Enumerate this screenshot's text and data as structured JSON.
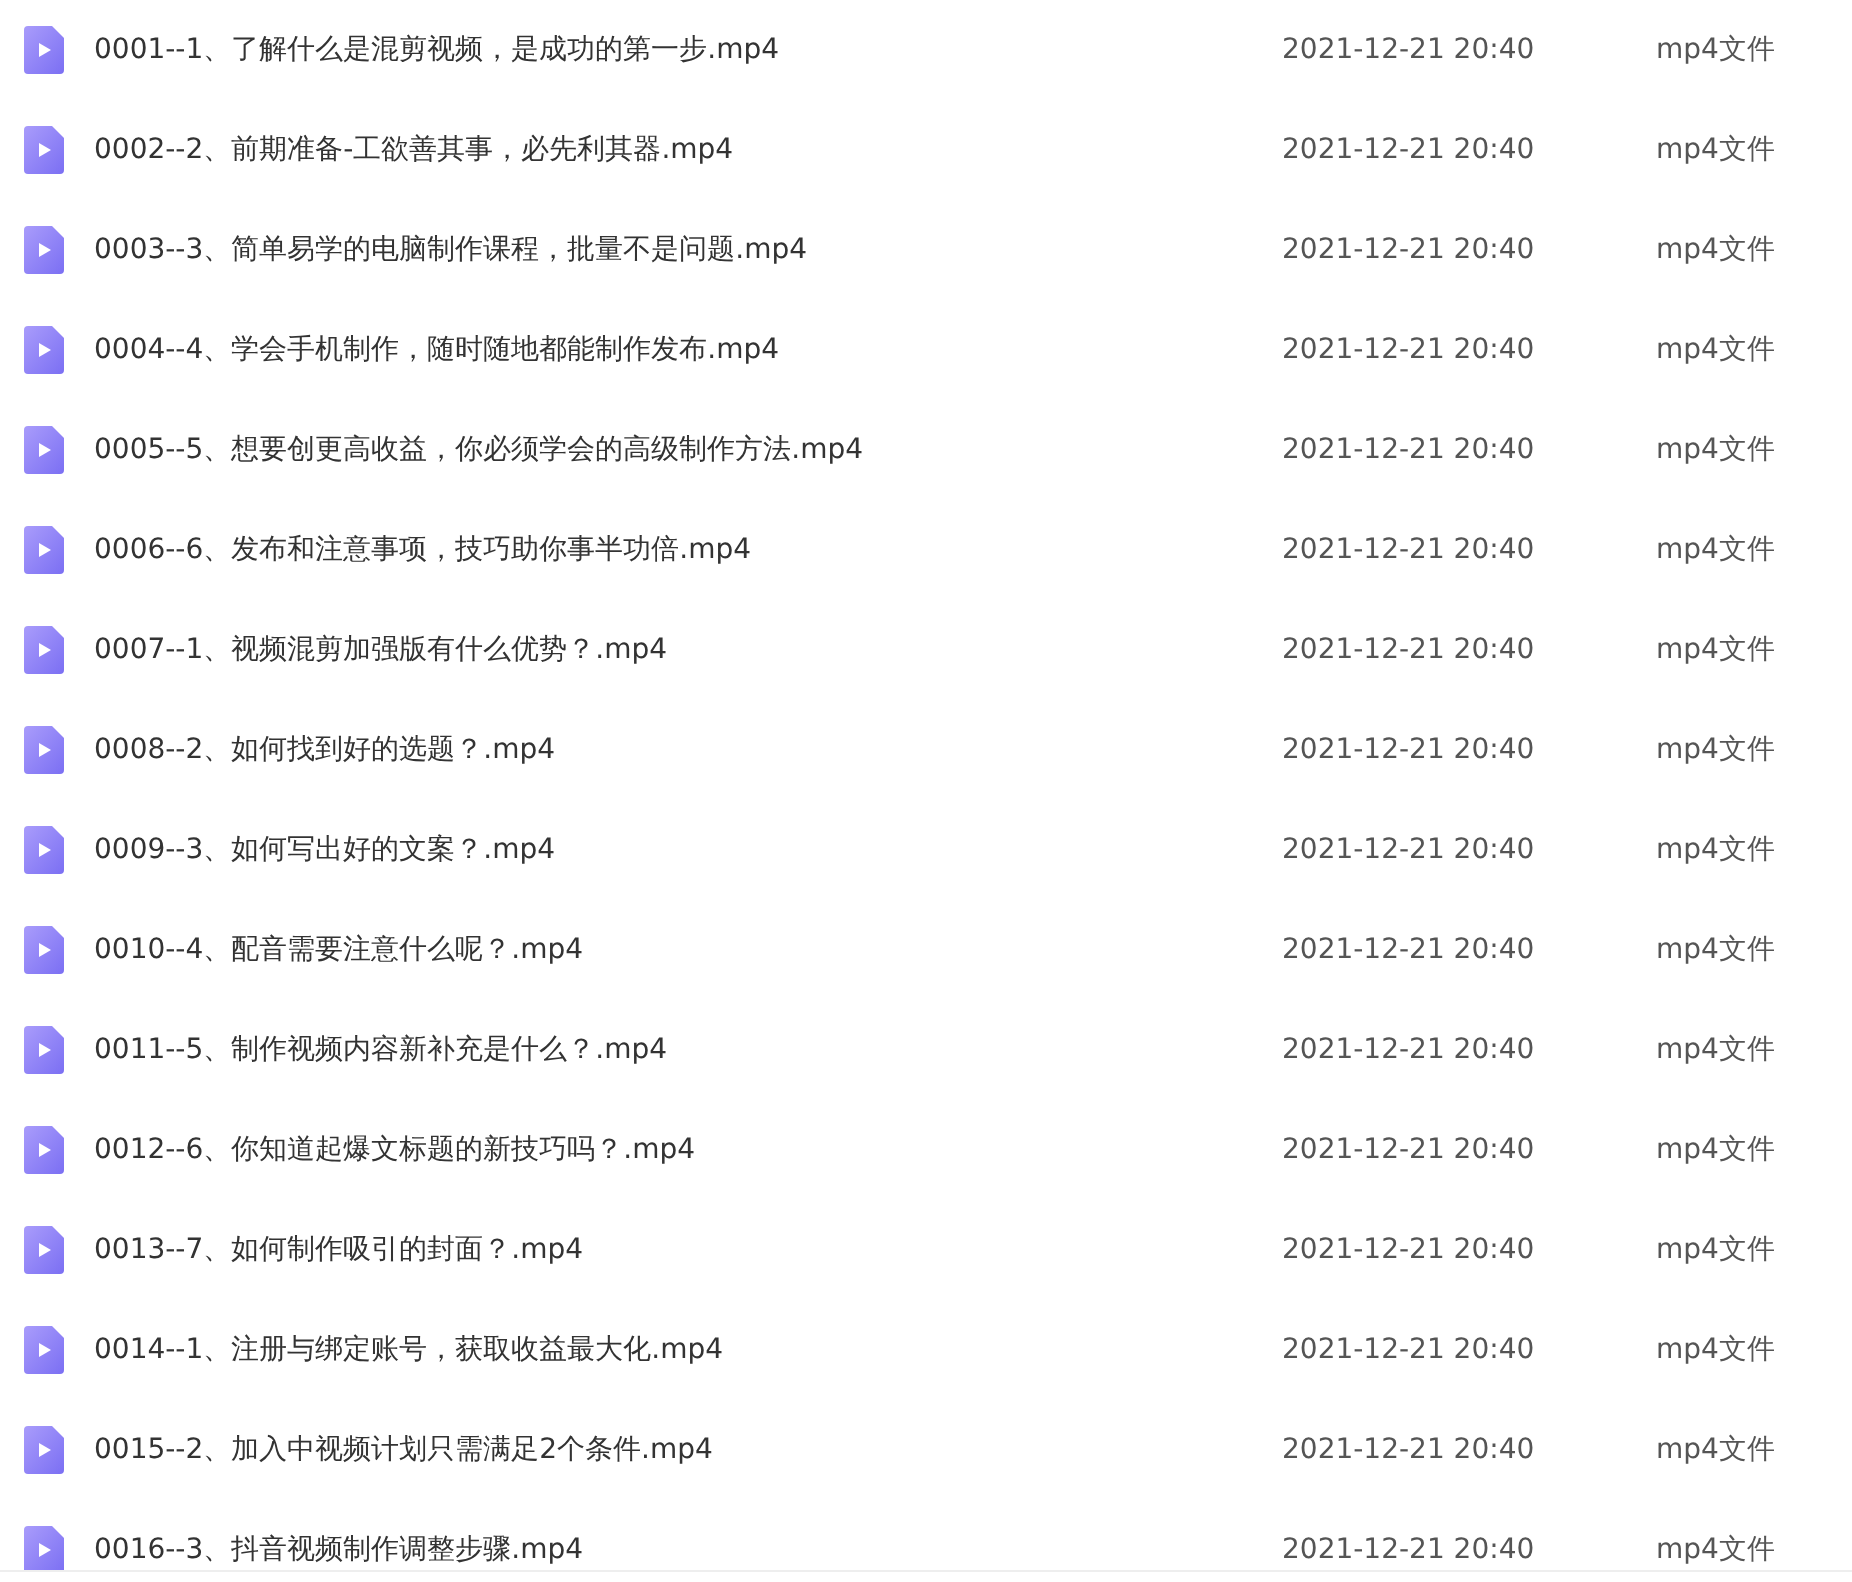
{
  "files": [
    {
      "name": "0001--1、了解什么是混剪视频，是成功的第一步.mp4",
      "modified": "2021-12-21 20:40",
      "type": "mp4文件"
    },
    {
      "name": "0002--2、前期准备-工欲善其事，必先利其器.mp4",
      "modified": "2021-12-21 20:40",
      "type": "mp4文件"
    },
    {
      "name": "0003--3、简单易学的电脑制作课程，批量不是问题.mp4",
      "modified": "2021-12-21 20:40",
      "type": "mp4文件"
    },
    {
      "name": "0004--4、学会手机制作，随时随地都能制作发布.mp4",
      "modified": "2021-12-21 20:40",
      "type": "mp4文件"
    },
    {
      "name": "0005--5、想要创更高收益，你必须学会的高级制作方法.mp4",
      "modified": "2021-12-21 20:40",
      "type": "mp4文件"
    },
    {
      "name": "0006--6、发布和注意事项，技巧助你事半功倍.mp4",
      "modified": "2021-12-21 20:40",
      "type": "mp4文件"
    },
    {
      "name": "0007--1、视频混剪加强版有什么优势？.mp4",
      "modified": "2021-12-21 20:40",
      "type": "mp4文件"
    },
    {
      "name": "0008--2、如何找到好的选题？.mp4",
      "modified": "2021-12-21 20:40",
      "type": "mp4文件"
    },
    {
      "name": "0009--3、如何写出好的文案？.mp4",
      "modified": "2021-12-21 20:40",
      "type": "mp4文件"
    },
    {
      "name": "0010--4、配音需要注意什么呢？.mp4",
      "modified": "2021-12-21 20:40",
      "type": "mp4文件"
    },
    {
      "name": "0011--5、制作视频内容新补充是什么？.mp4",
      "modified": "2021-12-21 20:40",
      "type": "mp4文件"
    },
    {
      "name": "0012--6、你知道起爆文标题的新技巧吗？.mp4",
      "modified": "2021-12-21 20:40",
      "type": "mp4文件"
    },
    {
      "name": "0013--7、如何制作吸引的封面？.mp4",
      "modified": "2021-12-21 20:40",
      "type": "mp4文件"
    },
    {
      "name": "0014--1、注册与绑定账号，获取收益最大化.mp4",
      "modified": "2021-12-21 20:40",
      "type": "mp4文件"
    },
    {
      "name": "0015--2、加入中视频计划只需满足2个条件.mp4",
      "modified": "2021-12-21 20:40",
      "type": "mp4文件"
    },
    {
      "name": "0016--3、抖音视频制作调整步骤.mp4",
      "modified": "2021-12-21 20:40",
      "type": "mp4文件"
    }
  ]
}
